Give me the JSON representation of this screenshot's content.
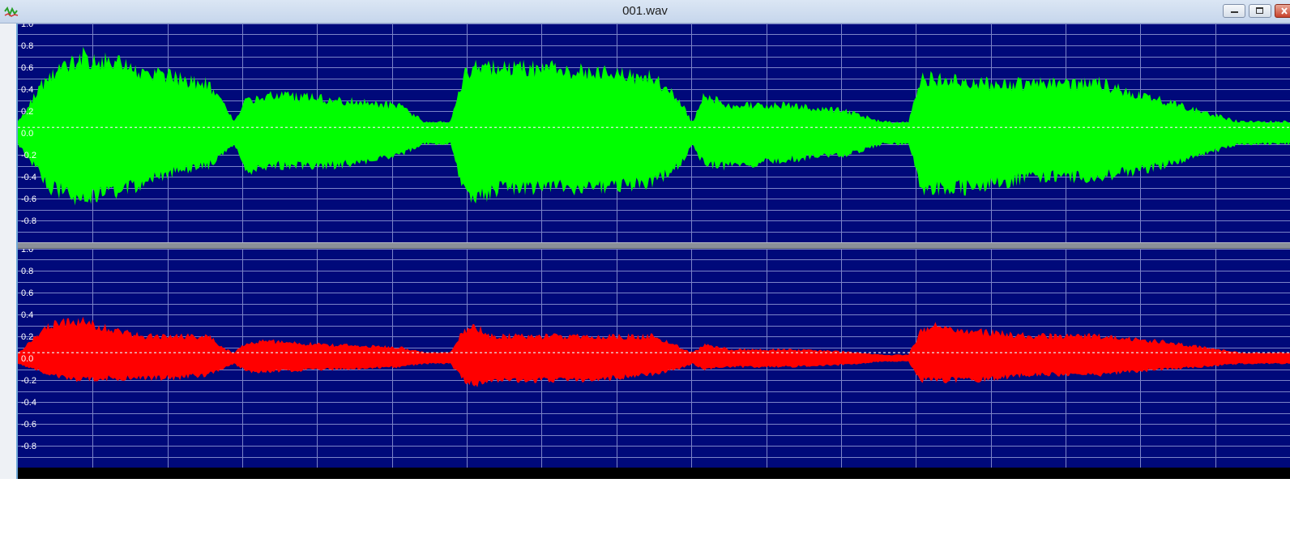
{
  "window": {
    "title": "001.wav",
    "app_icon": "waveform-app-icon",
    "controls": [
      "minimize-icon",
      "maximize-icon",
      "close-icon"
    ]
  },
  "colors": {
    "background": "#00097a",
    "grid": "#7b84c8",
    "centerline": "#e8e8e8",
    "channel_top": "#00ff00",
    "channel_bottom": "#ff0000"
  },
  "chart_data": [
    {
      "type": "area",
      "ylim": [
        -1.0,
        1.0
      ],
      "ytick_labels": [
        "1.0",
        "0.8",
        "0.6",
        "0.4",
        "0.2",
        "0.0",
        "-0.2",
        "-0.4",
        "-0.6",
        "-0.8"
      ],
      "grid": true,
      "x": [
        0,
        0.025,
        0.05,
        0.075,
        0.1,
        0.125,
        0.15,
        0.16,
        0.17,
        0.18,
        0.2,
        0.25,
        0.3,
        0.32,
        0.34,
        0.35,
        0.36,
        0.37,
        0.38,
        0.4,
        0.45,
        0.5,
        0.52,
        0.53,
        0.54,
        0.55,
        0.56,
        0.6,
        0.65,
        0.68,
        0.69,
        0.7,
        0.7,
        0.71,
        0.72,
        0.75,
        0.8,
        0.85,
        0.9,
        0.93,
        0.96,
        1.0
      ],
      "series": [
        {
          "upper": [
            0.1,
            0.55,
            0.7,
            0.65,
            0.55,
            0.5,
            0.45,
            0.3,
            0.1,
            0.3,
            0.35,
            0.3,
            0.25,
            0.1,
            0.1,
            0.5,
            0.65,
            0.6,
            0.6,
            0.6,
            0.55,
            0.5,
            0.3,
            0.1,
            0.35,
            0.3,
            0.25,
            0.25,
            0.2,
            0.1,
            0.1,
            0.1,
            0.1,
            0.5,
            0.5,
            0.45,
            0.45,
            0.45,
            0.3,
            0.2,
            0.1,
            0.1
          ],
          "lower": [
            -0.1,
            -0.5,
            -0.6,
            -0.55,
            -0.45,
            -0.35,
            -0.3,
            -0.2,
            -0.1,
            -0.35,
            -0.3,
            -0.3,
            -0.2,
            -0.1,
            -0.1,
            -0.5,
            -0.6,
            -0.55,
            -0.5,
            -0.5,
            -0.5,
            -0.45,
            -0.3,
            -0.1,
            -0.3,
            -0.3,
            -0.3,
            -0.25,
            -0.2,
            -0.1,
            -0.1,
            -0.1,
            -0.1,
            -0.5,
            -0.5,
            -0.5,
            -0.4,
            -0.4,
            -0.3,
            -0.2,
            -0.1,
            -0.1
          ]
        },
        {
          "upper": [
            0.05,
            0.3,
            0.35,
            0.25,
            0.2,
            0.2,
            0.2,
            0.1,
            0.05,
            0.15,
            0.15,
            0.12,
            0.1,
            0.05,
            0.05,
            0.25,
            0.3,
            0.2,
            0.2,
            0.2,
            0.2,
            0.2,
            0.1,
            0.05,
            0.12,
            0.1,
            0.08,
            0.08,
            0.06,
            0.03,
            0.03,
            0.03,
            0.03,
            0.25,
            0.3,
            0.25,
            0.2,
            0.2,
            0.15,
            0.1,
            0.05,
            0.05
          ],
          "lower": [
            -0.05,
            -0.15,
            -0.2,
            -0.18,
            -0.18,
            -0.18,
            -0.15,
            -0.1,
            -0.05,
            -0.12,
            -0.12,
            -0.1,
            -0.08,
            -0.05,
            -0.05,
            -0.2,
            -0.25,
            -0.2,
            -0.2,
            -0.2,
            -0.2,
            -0.15,
            -0.1,
            -0.05,
            -0.1,
            -0.08,
            -0.08,
            -0.08,
            -0.06,
            -0.03,
            -0.03,
            -0.03,
            -0.03,
            -0.2,
            -0.2,
            -0.2,
            -0.15,
            -0.15,
            -0.1,
            -0.08,
            -0.05,
            -0.05
          ]
        }
      ]
    }
  ]
}
